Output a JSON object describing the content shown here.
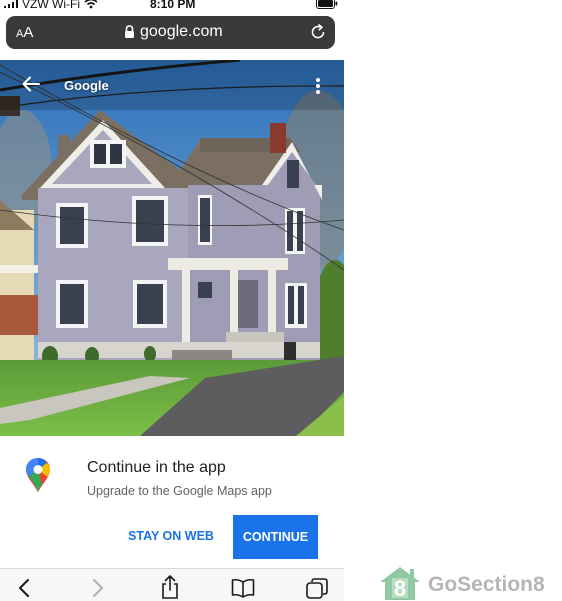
{
  "status_bar": {
    "carrier": "VZW Wi-Fi",
    "time": "8:10 PM"
  },
  "url_bar": {
    "text_size_big": "A",
    "text_size_small": "A",
    "url": "google.com"
  },
  "photo": {
    "title": "Google"
  },
  "card": {
    "title": "Continue in the app",
    "subtitle": "Upgrade to the Google Maps app",
    "stay_label": "STAY ON WEB",
    "continue_label": "CONTINUE"
  },
  "watermark": {
    "text": "GoSection8",
    "logo_digit": "8"
  },
  "colors": {
    "accent": "#1a73e8",
    "url_bar_bg": "#3a3a3c",
    "toolbar_bg": "#f7f7f7",
    "watermark_green": "#8fc9a3"
  },
  "icons": {
    "status": [
      "signal-icon",
      "wifi-icon",
      "battery-icon"
    ],
    "url_bar": [
      "lock-icon",
      "reload-icon"
    ],
    "photo": [
      "back-arrow-icon",
      "more-icon"
    ],
    "card": [
      "maps-pin-icon"
    ],
    "toolbar": [
      "back-icon",
      "forward-icon",
      "share-icon",
      "bookmarks-icon",
      "tabs-icon"
    ]
  }
}
